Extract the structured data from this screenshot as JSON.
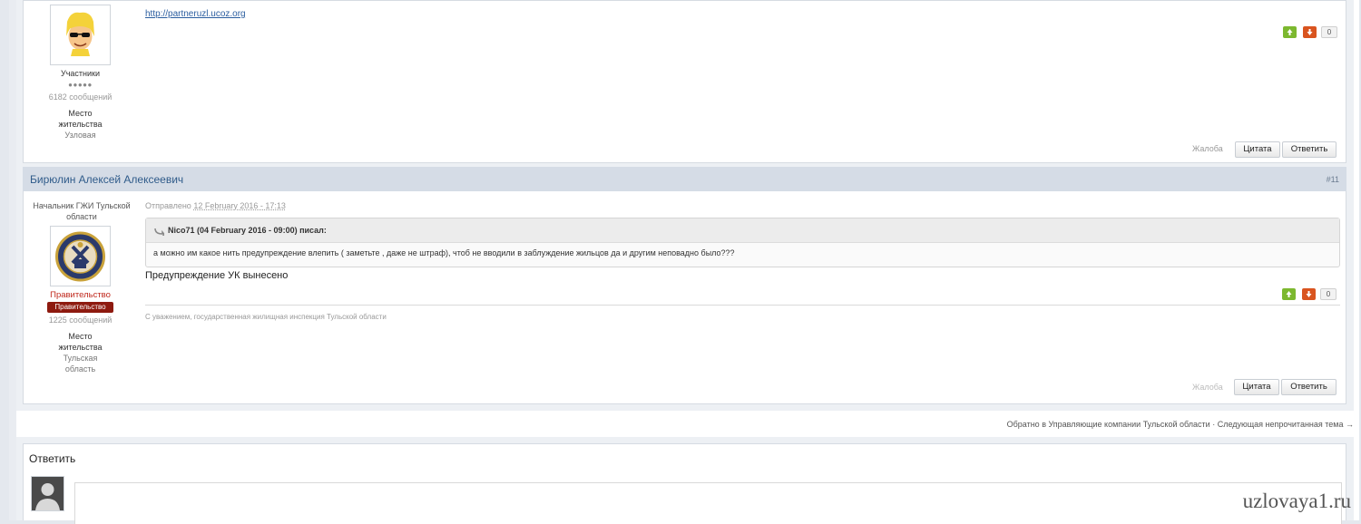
{
  "post1": {
    "website_link": "http://partneruzl.ucoz.org",
    "group": "Участники",
    "pips": "●●●●●",
    "posts_count": "6182 сообщений",
    "location_label": "Место жительства",
    "location_value": "Узловая",
    "rep_count": "0",
    "report": "Жалоба",
    "quote_btn": "Цитата",
    "reply_btn": "Ответить"
  },
  "post2": {
    "author_name": "Бирюлин Алексей Алексеевич",
    "post_number": "#11",
    "title": "Начальник ГЖИ Тульской области",
    "posted_label": "Отправлено",
    "posted_date": "12 February 2016 - 17:13",
    "quote_author": "Nico71 (04 February 2016 - 09:00) писал:",
    "quote_text": "а можно им какое нить предупреждение влепить ( заметьте , даже не штраф), чтоб не вводили в заблуждение жильцов да и другим неповадно было???",
    "post_text": "Предупреждение УК вынесено",
    "group": "Правительство",
    "group_badge": "Правительство",
    "posts_count": "1225 сообщений",
    "location_label": "Место жительства",
    "location_value": "Тульская область",
    "signature": "С уважением, государственная жилищная инспекция Тульской области",
    "rep_count": "0",
    "report": "Жалоба",
    "quote_btn": "Цитата",
    "reply_btn": "Ответить"
  },
  "nav": {
    "back_link": "Обратно в Управляющие компании Тульской области",
    "separator": "·",
    "next_link": "Следующая непрочитанная тема →"
  },
  "reply_box": {
    "title": "Ответить"
  },
  "watermark": "uzlovaya1.ru",
  "colors": {
    "header_bar": "#d5dce6",
    "author_link": "#2f5b8a",
    "vote_up": "#7cb82f",
    "vote_down": "#d9541f",
    "group_red": "#c0281c"
  }
}
